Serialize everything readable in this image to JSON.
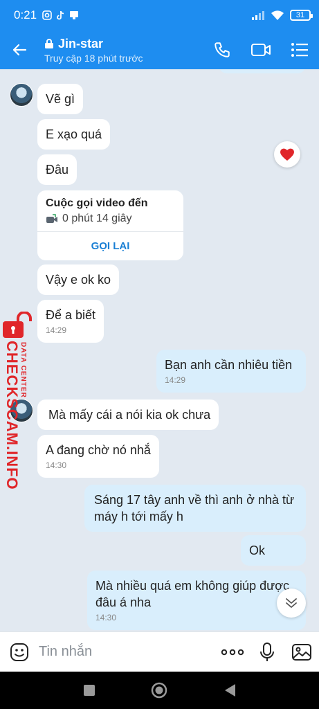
{
  "status_bar": {
    "time": "0:21",
    "battery": "31"
  },
  "header": {
    "title": "Jin-star",
    "subtitle": "Truy cập 18 phút trước"
  },
  "messages": [
    {
      "text": "Vẽ gì"
    },
    {
      "text": "E xạo quá"
    },
    {
      "text": "Đâu"
    },
    {
      "text": "Vậy e ok ko"
    },
    {
      "text": "Để a biết",
      "time": "14:29"
    },
    {
      "text": "Bạn anh cần nhiêu tiền",
      "time": "14:29"
    },
    {
      "text": "Mà mấy cái a nói kia ok chưa"
    },
    {
      "text": "A đang chờ nó nhắ",
      "time": "14:30"
    },
    {
      "text": "Sáng 17 tây anh về thì anh ở nhà từ máy h tới mấy h"
    },
    {
      "text": "Ok"
    },
    {
      "text": "Mà nhiều quá em không giúp được đâu á nha",
      "time": "14:30"
    }
  ],
  "call_card": {
    "title": "Cuộc gọi video đến",
    "duration": "0 phút 14 giây",
    "action": "GỌI LẠI"
  },
  "watermark": {
    "text": "CHECKSCAM.INFO",
    "small": "DATA CENTER"
  },
  "input": {
    "placeholder": "Tin nhắn"
  },
  "colors": {
    "header": "#1e8df0",
    "background": "#e2e9f1",
    "outgoing": "#d9eefc",
    "link": "#1a7fd4",
    "heart": "#e0262a"
  },
  "icons": [
    "back-arrow-icon",
    "lock-icon",
    "phone-icon",
    "video-camera-icon",
    "list-menu-icon",
    "heart-icon",
    "chevron-double-down-icon",
    "emoji-icon",
    "more-icon",
    "microphone-icon",
    "image-icon",
    "nav-square-icon",
    "nav-circle-icon",
    "nav-back-icon"
  ]
}
